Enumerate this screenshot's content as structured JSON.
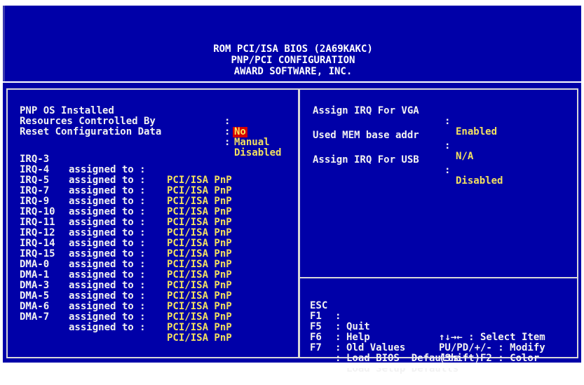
{
  "header": {
    "line1": "ROM PCI/ISA BIOS (2A69KAKC)",
    "line2": "PNP/PCI CONFIGURATION",
    "line3": "AWARD SOFTWARE, INC."
  },
  "left_top": [
    {
      "label": "PNP OS Installed",
      "sep": ":",
      "value": "No"
    },
    {
      "label": "Resources Controlled By",
      "sep": ":",
      "value": "Manual"
    },
    {
      "label": "Reset Configuration Data",
      "sep": ":",
      "value": "Disabled"
    }
  ],
  "assignments": [
    {
      "name": "IRQ-3",
      "mid": "assigned to :",
      "value": "PCI/ISA PnP"
    },
    {
      "name": "IRQ-4",
      "mid": "assigned to :",
      "value": "PCI/ISA PnP"
    },
    {
      "name": "IRQ-5",
      "mid": "assigned to :",
      "value": "PCI/ISA PnP"
    },
    {
      "name": "IRQ-7",
      "mid": "assigned to :",
      "value": "PCI/ISA PnP"
    },
    {
      "name": "IRQ-9",
      "mid": "assigned to :",
      "value": "PCI/ISA PnP"
    },
    {
      "name": "IRQ-10",
      "mid": "assigned to :",
      "value": "PCI/ISA PnP"
    },
    {
      "name": "IRQ-11",
      "mid": "assigned to :",
      "value": "PCI/ISA PnP"
    },
    {
      "name": "IRQ-12",
      "mid": "assigned to :",
      "value": "PCI/ISA PnP"
    },
    {
      "name": "IRQ-14",
      "mid": "assigned to :",
      "value": "PCI/ISA PnP"
    },
    {
      "name": "IRQ-15",
      "mid": "assigned to :",
      "value": "PCI/ISA PnP"
    },
    {
      "name": "DMA-0",
      "mid": "assigned to :",
      "value": "PCI/ISA PnP"
    },
    {
      "name": "DMA-1",
      "mid": "assigned to :",
      "value": "PCI/ISA PnP"
    },
    {
      "name": "DMA-3",
      "mid": "assigned to :",
      "value": "PCI/ISA PnP"
    },
    {
      "name": "DMA-5",
      "mid": "assigned to :",
      "value": "PCI/ISA PnP"
    },
    {
      "name": "DMA-6",
      "mid": "assigned to :",
      "value": "PCI/ISA PnP"
    },
    {
      "name": "DMA-7",
      "mid": "assigned to :",
      "value": "PCI/ISA PnP"
    }
  ],
  "right_settings": [
    {
      "label": "Assign IRQ For VGA",
      "sep": ":",
      "value": "Enabled"
    },
    {
      "label": "Used MEM base addr",
      "sep": ":",
      "value": "N/A"
    },
    {
      "label": "Assign IRQ For USB",
      "sep": ":",
      "value": "Disabled"
    }
  ],
  "help_keys": [
    {
      "key": "ESC",
      "sep": ":",
      "action": "Quit",
      "right": "↑↓→← : Select Item"
    },
    {
      "key": "F1",
      "sep": ":",
      "action": "Help",
      "right": "PU/PD/+/- : Modify"
    },
    {
      "key": "F5",
      "sep": ":",
      "action": "Old Values",
      "right": "(Shift)F2 : Color"
    },
    {
      "key": "F6",
      "sep": ":",
      "action": "Load BIOS  Defaults",
      "right": ""
    },
    {
      "key": "F7",
      "sep": ":",
      "action": "Load Setup Defaults",
      "right": ""
    }
  ],
  "colors": {
    "background": "#0000a8",
    "text": "#f2f2f2",
    "value": "#f2e060",
    "highlight": "#d40000"
  }
}
